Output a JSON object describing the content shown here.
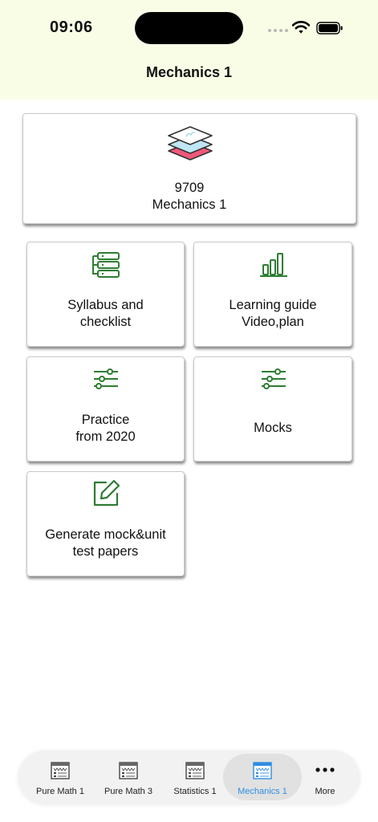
{
  "status": {
    "time": "09:06"
  },
  "nav": {
    "title": "Mechanics 1"
  },
  "header_card": {
    "code": "9709",
    "subject": "Mechanics 1"
  },
  "menu": {
    "syllabus": "Syllabus and\nchecklist",
    "learning_guide": "Learning guide\nVideo,plan",
    "practice": "Practice\nfrom 2020",
    "mocks": "Mocks",
    "generate": "Generate mock&unit\ntest papers"
  },
  "tabs": [
    {
      "label": "Pure Math 1",
      "icon": "browser-window-icon"
    },
    {
      "label": "Pure Math 3",
      "icon": "browser-window-icon"
    },
    {
      "label": "Statistics 1",
      "icon": "browser-window-icon"
    },
    {
      "label": "Mechanics 1",
      "icon": "browser-window-icon",
      "active": true
    },
    {
      "label": "More",
      "icon": "ellipsis-icon"
    }
  ],
  "colors": {
    "accent_green": "#2e7d32",
    "active_tab": "#2f8de4",
    "top_bg": "#fafde6"
  }
}
